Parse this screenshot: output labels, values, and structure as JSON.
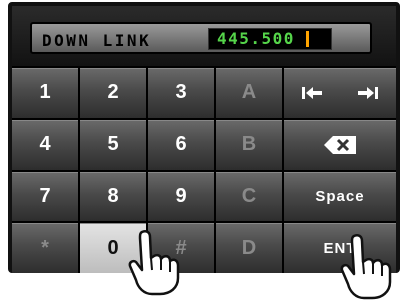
{
  "display": {
    "label": "DOWN LINK",
    "value": "445.500"
  },
  "keys": {
    "row1": [
      "1",
      "2",
      "3",
      "A"
    ],
    "row2": [
      "4",
      "5",
      "6",
      "B"
    ],
    "row3": [
      "7",
      "8",
      "9",
      "C"
    ],
    "row4": [
      "*",
      "0",
      "#",
      "D"
    ],
    "cursor_left_glyph": "|◀",
    "cursor_right_glyph": "▶|",
    "space_label": "Space",
    "enter_label": "ENT"
  },
  "icons": {
    "cursor_left": "cursor-left-icon",
    "cursor_right": "cursor-right-icon",
    "backspace": "backspace-icon",
    "hand": "pointing-hand-icon"
  },
  "colors": {
    "frequency_text": "#55d44a",
    "cursor": "#ffa400",
    "pressed_key": "#d0d0d0"
  }
}
